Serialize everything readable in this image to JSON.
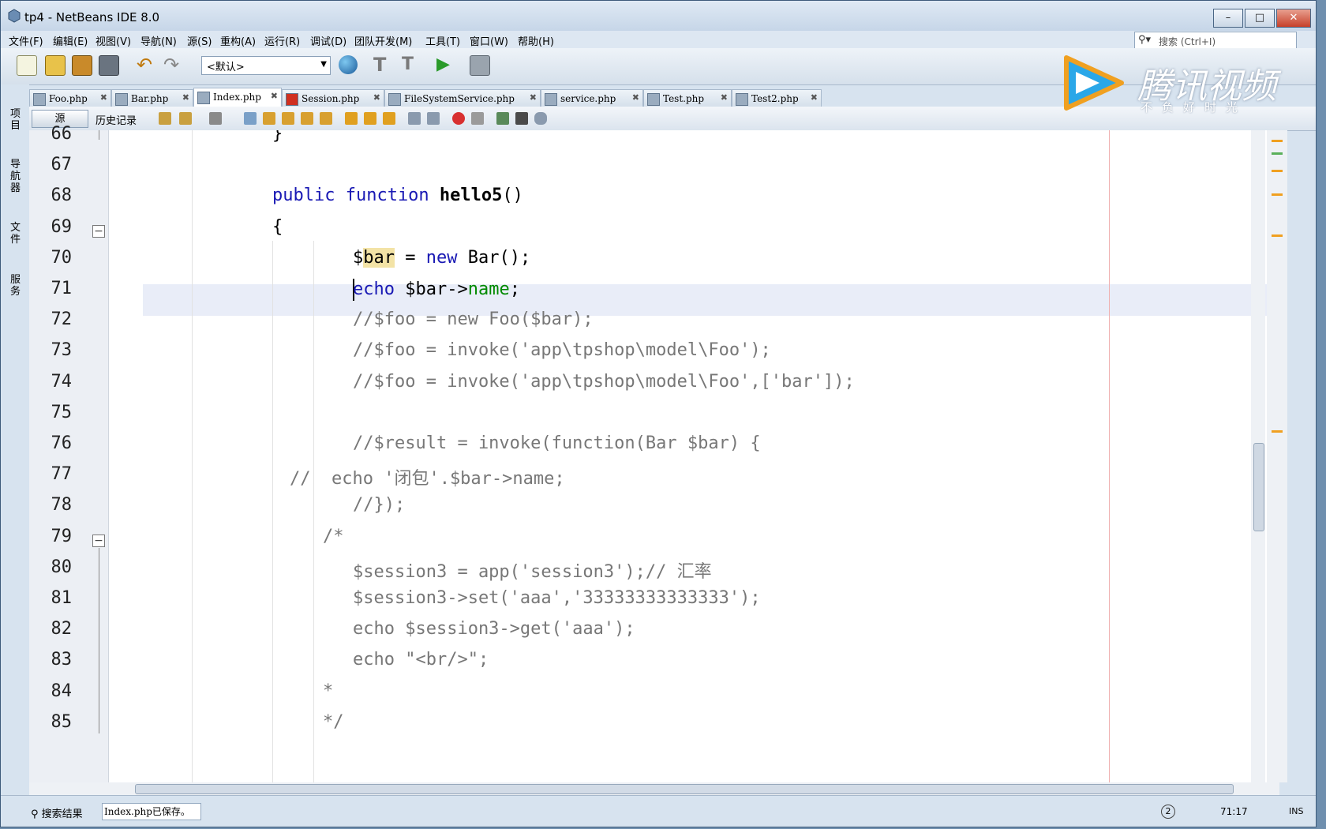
{
  "window": {
    "title": "tp4 - NetBeans IDE 8.0"
  },
  "menu": [
    "文件(F)",
    "编辑(E)",
    "视图(V)",
    "导航(N)",
    "源(S)",
    "重构(A)",
    "运行(R)",
    "调试(D)",
    "团队开发(M)",
    "工具(T)",
    "窗口(W)",
    "帮助(H)"
  ],
  "search": {
    "placeholder": "搜索 (Ctrl+I)"
  },
  "toolbar": {
    "config_value": "<默认>"
  },
  "side_tabs": [
    "项目",
    "导航器",
    "文件",
    "服务"
  ],
  "tabs": [
    {
      "label": "Foo.php"
    },
    {
      "label": "Bar.php"
    },
    {
      "label": "Index.php",
      "active": true
    },
    {
      "label": "Session.php"
    },
    {
      "label": "FileSystemService.php"
    },
    {
      "label": "service.php"
    },
    {
      "label": "Test.php"
    },
    {
      "label": "Test2.php"
    }
  ],
  "editor_toolbar": {
    "source_label": "源",
    "history_label": "历史记录"
  },
  "code": [
    {
      "num": "66",
      "text": "}"
    },
    {
      "num": "67",
      "text": ""
    },
    {
      "num": "68",
      "text": "public function hello5()"
    },
    {
      "num": "69",
      "text": "{"
    },
    {
      "num": "70",
      "text": "$bar = new Bar();"
    },
    {
      "num": "71",
      "text": "echo $bar->name;"
    },
    {
      "num": "72",
      "text": "//$foo = new Foo($bar);"
    },
    {
      "num": "73",
      "text": "//$foo = invoke('app\\tpshop\\model\\Foo');"
    },
    {
      "num": "74",
      "text": "//$foo = invoke('app\\tpshop\\model\\Foo',['bar']);"
    },
    {
      "num": "75",
      "text": ""
    },
    {
      "num": "76",
      "text": "//$result = invoke(function(Bar $bar) {"
    },
    {
      "num": "77",
      "text": "//  echo '闭包'.$bar->name;"
    },
    {
      "num": "78",
      "text": "//});"
    },
    {
      "num": "79",
      "text": "/*"
    },
    {
      "num": "80",
      "text": "$session3 = app('session3');// 汇率"
    },
    {
      "num": "81",
      "text": "$session3->set('aaa','33333333333333');"
    },
    {
      "num": "82",
      "text": "echo $session3->get('aaa');"
    },
    {
      "num": "83",
      "text": "echo \"<br/>\";"
    },
    {
      "num": "84",
      "text": "*"
    },
    {
      "num": "85",
      "text": "*/"
    }
  ],
  "status": {
    "search_results": "搜索结果",
    "message": "Index.php已保存。",
    "position": "71:17",
    "insert_mode": "INS"
  },
  "watermark": {
    "brand": "腾讯视频",
    "slogan": "不负好时光"
  },
  "colors": {
    "keyword": "#1919b4",
    "comment": "#777777",
    "field": "#008a00",
    "highlight": "#e9edf8",
    "close": "#c6402a"
  },
  "icons": [
    "app-icon",
    "new-project-icon",
    "new-file-icon",
    "open-project-icon",
    "save-all-icon",
    "undo-icon",
    "redo-icon",
    "globe-icon",
    "build-icon",
    "clean-build-icon",
    "run-icon",
    "debug-icon"
  ]
}
